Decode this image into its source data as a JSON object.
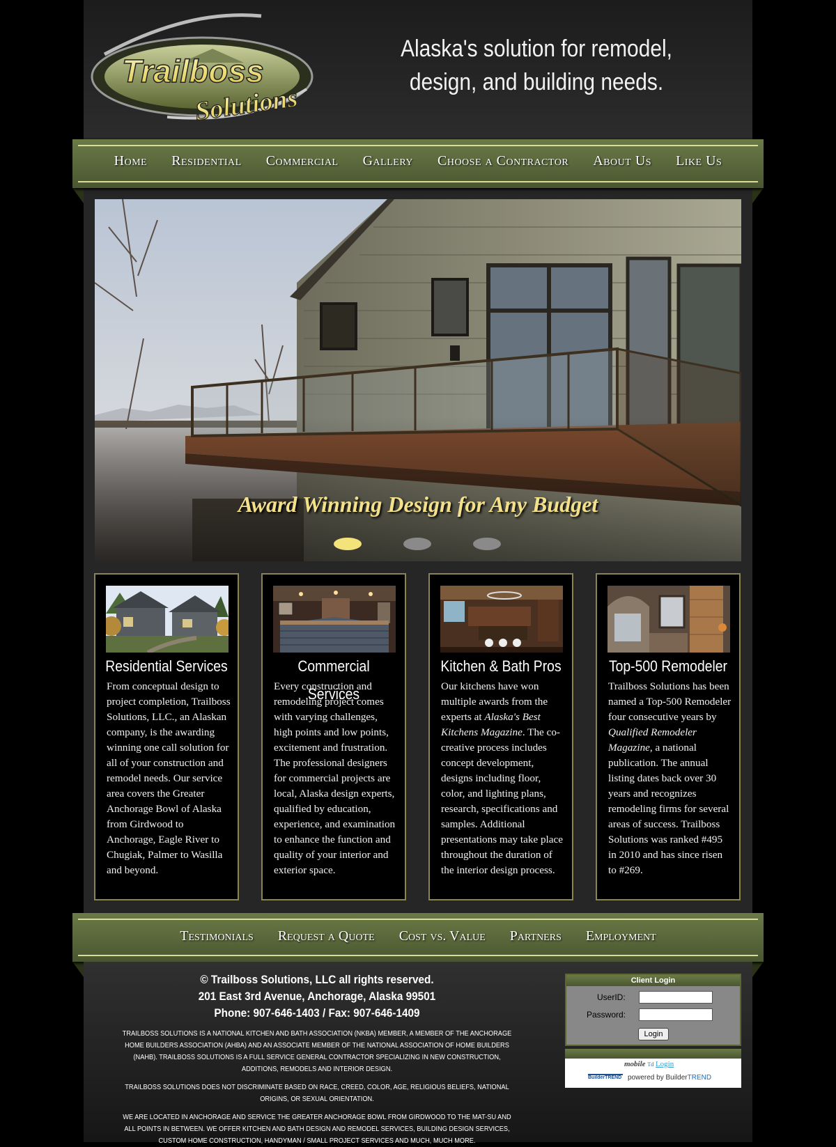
{
  "header": {
    "logo_text_1": "Trailboss",
    "logo_text_2": "Solutions",
    "tagline_line1": "Alaska's solution for remodel,",
    "tagline_line2": "design, and building needs."
  },
  "nav": [
    "Home",
    "Residential",
    "Commercial",
    "Gallery",
    "Choose a Contractor",
    "About Us",
    "Like Us"
  ],
  "hero": {
    "caption": "Award Winning Design for Any Budget",
    "slides": 3,
    "active_slide": 1
  },
  "cards": [
    {
      "title": "Residential Services",
      "text": "From conceptual design to project completion, Trailboss Solutions, LLC., an Alaskan company, is the awarding winning one call solution for all of your construction and remodel needs. Our service area covers the Greater Anchorage Bowl of Alaska from Girdwood to Anchorage, Eagle River to Chugiak, Palmer to Wasilla and beyond."
    },
    {
      "title": "Commercial Services",
      "text": "Every construction and remodeling project comes with varying challenges, high points and low points, excitement and frustration. The professional designers for commercial projects are local, Alaska design experts, qualified by education, experience, and examination to enhance the function and quality of your interior and exterior space."
    },
    {
      "title": "Kitchen & Bath Pros",
      "text_1": "Our kitchens have won multiple awards from the experts at ",
      "text_italic": "Alaska's Best Kitchens Magazine",
      "text_2": ". The co-creative process includes concept development, designs including floor, color, and lighting plans, research, specifications and samples. Additional presentations may take place throughout the duration of the interior design process."
    },
    {
      "title": "Top-500 Remodeler",
      "text_1": "Trailboss Solutions has been named a Top-500 Remodeler four consecutive years by ",
      "text_italic": "Qualified Remodeler Magazine",
      "text_2": ", a national publication. The annual listing dates back over 30 years and recognizes remodeling firms for several areas of success. Trailboss Solutions was ranked #495 in 2010 and has since risen to #269."
    }
  ],
  "footer_nav": [
    "Testimonials",
    "Request a Quote",
    "Cost vs. Value",
    "Partners",
    "Employment"
  ],
  "footer": {
    "copyright": "© Trailboss Solutions, LLC  all rights reserved.",
    "address": "201 East 3rd Avenue, Anchorage, Alaska 99501",
    "phone": "Phone: 907-646-1403 / Fax: 907-646-1409",
    "para1": "Trailboss Solutions is a National Kitchen and Bath Association (NKBA) member, a member of the Anchorage Home Builders Association (AHBA) and an associate member of the National Association of Home Builders (NAHB). Trailboss Solutions is a full service general contractor specializing in new construction, additions, remodels and interior design.",
    "para2": "Trailboss Solutions does not discriminate based on race, creed, color, age, religious beliefs, national origins, or sexual orientation.",
    "para3": "We are located in Anchorage and service the Greater Anchorage Bowl from Girdwood to the Mat-Su and all points in between. We offer kitchen and bath design and remodel services, building design services, custom home construction, handyman / small project services and much, much more."
  },
  "login": {
    "title": "Client Login",
    "userid_label": "UserID:",
    "password_label": "Password:",
    "button": "Login"
  },
  "mobile": {
    "mobile_word": "mobile",
    "td": "Td",
    "login": "Login",
    "logo_text": "BuilderTREND",
    "powered_prefix": "powered by Builder",
    "powered_suffix": "TREND"
  },
  "colors": {
    "nav_green": "#5c6a3a",
    "caption_yellow": "#f3e08b",
    "card_border": "#8a8450"
  }
}
